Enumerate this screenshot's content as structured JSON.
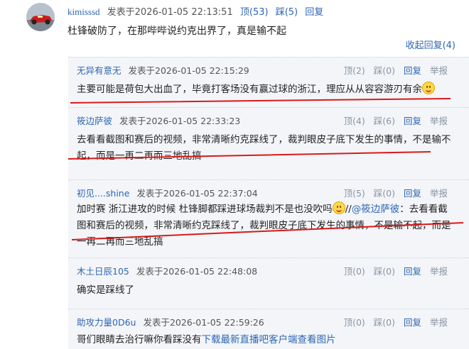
{
  "main_post": {
    "username": "kimisssd",
    "posted": "发表于2026-01-05 22:13:51",
    "up": "顶(53)",
    "down": "踩(5)",
    "reply": "回复",
    "content": "杜锋破防了，在那哔哔说约克出界了，真是输不起",
    "collapse": "收起回复(4)"
  },
  "replies": [
    {
      "username": "无异有意无",
      "posted": "发表于2026-01-05 22:15:29",
      "up": "顶(2)",
      "down": "踩(0)",
      "reply": "回复",
      "report": "举报",
      "content": "主要可能是荷包大出血了，毕竟打客场没有赢过球的浙江，理应从从容容游刃有余",
      "has_emoji": true
    },
    {
      "username": "筱边萨彼",
      "posted": "发表于2026-01-05 22:33:23",
      "up": "顶(4)",
      "down": "踩(6)",
      "reply": "回复",
      "report": "举报",
      "content": "去看看截图和赛后的视频，非常清晰约克踩线了，裁判眼皮子底下发生的事情，不是输不起，而是一再二再而三地乱搞"
    },
    {
      "username": "初见....shine",
      "posted": "发表于2026-01-05 22:37:04",
      "up": "顶(5)",
      "down": "踩(0)",
      "reply": "回复",
      "report": "举报",
      "content_before": "加时赛 浙江进攻的时候 杜锋脚都踩进球场裁判不是也没吹吗",
      "content_mention_prefix": "//",
      "content_mention": "@筱边萨彼",
      "content_after": "：去看看截图和赛后的视频，非常清晰约克踩线了，裁判眼皮子底下发生的事情，不是输不起，而是一再二再而三地乱搞"
    },
    {
      "username": "木土日辰105",
      "posted": "发表于2026-01-05 22:48:08",
      "up": "顶(0)",
      "down": "踩(0)",
      "reply": "回复",
      "report": "举报",
      "content": "确实是踩线了"
    },
    {
      "username": "助攻力量0D6u",
      "posted": "发表于2026-01-05 22:59:26",
      "up": "顶(0)",
      "down": "踩(0)",
      "reply": "回复",
      "report": "举报",
      "content_before": "哥们眼睛去治行嘛你看踩没有",
      "content_link": "下载最新直播吧客户端查看图片"
    }
  ],
  "colors": {
    "link": "#2f66b3",
    "reply_bg": "#f3f5f8",
    "underline": "#d91a1a"
  }
}
